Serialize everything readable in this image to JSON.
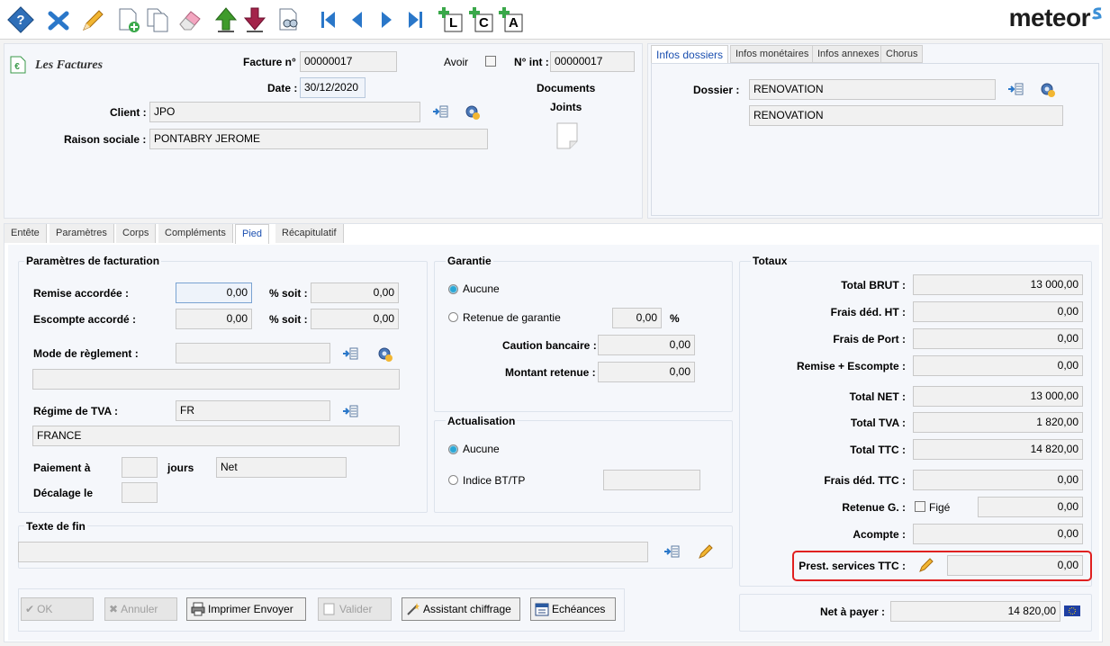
{
  "brand": "meteor",
  "toolbar": {
    "icons": [
      "help-icon",
      "delete-icon",
      "edit-icon",
      "new-doc-icon",
      "copy-doc-icon",
      "eraser-icon",
      "arrow-up-icon",
      "arrow-down-icon",
      "print-preview-icon",
      "first-icon",
      "prev-icon",
      "next-icon",
      "last-icon",
      "add-l-icon",
      "add-c-icon",
      "add-a-icon"
    ],
    "letters": {
      "l": "L",
      "c": "C",
      "a": "A"
    }
  },
  "header": {
    "module_title": "Les Factures",
    "facture_label": "Facture n°",
    "facture_value": "00000017",
    "avoir_label": "Avoir",
    "nint_label": "N° int :",
    "nint_value": "00000017",
    "date_label": "Date :",
    "date_value": "30/12/2020",
    "client_label": "Client :",
    "client_value": "JPO",
    "raison_label": "Raison sociale :",
    "raison_value": "PONTABRY JEROME",
    "documents_label": "Documents",
    "joints_label": "Joints"
  },
  "right_tabs": {
    "tabs": [
      "Infos dossiers",
      "Infos monétaires",
      "Infos annexes",
      "Chorus"
    ],
    "dossier_label": "Dossier :",
    "dossier_value": "RENOVATION",
    "dossier_desc": "RENOVATION"
  },
  "tabs": [
    "Entête",
    "Paramètres",
    "Corps",
    "Compléments",
    "Pied",
    "Récapitulatif"
  ],
  "facturation": {
    "title": "Paramètres de facturation",
    "remise_label": "Remise accordée :",
    "remise_value": "0,00",
    "escompte_label": "Escompte accordé :",
    "escompte_value": "0,00",
    "pct_label": "% soit :",
    "remise_soit": "0,00",
    "escompte_soit": "0,00",
    "mode_label": "Mode de règlement :",
    "regime_label": "Régime de TVA :",
    "regime_value": "FR",
    "regime_desc": "FRANCE",
    "paiement_label": "Paiement à",
    "jours_label": "jours",
    "paiement_type": "Net",
    "decalage_label": "Décalage le"
  },
  "garantie": {
    "title": "Garantie",
    "aucune": "Aucune",
    "retenue_label": "Retenue de garantie",
    "retenue_value": "0,00",
    "pct": "%",
    "caution_label": "Caution bancaire :",
    "caution_value": "0,00",
    "montant_label": "Montant retenue :",
    "montant_value": "0,00"
  },
  "actualisation": {
    "title": "Actualisation",
    "aucune": "Aucune",
    "indice_label": "Indice BT/TP"
  },
  "texte_fin": {
    "title": "Texte de fin"
  },
  "totaux": {
    "title": "Totaux",
    "rows": [
      {
        "label": "Total BRUT :",
        "value": "13 000,00"
      },
      {
        "label": "Frais déd. HT :",
        "value": "0,00"
      },
      {
        "label": "Frais de Port :",
        "value": "0,00"
      },
      {
        "label": "Remise + Escompte :",
        "value": "0,00"
      },
      {
        "label": "Total NET :",
        "value": "13 000,00"
      },
      {
        "label": "Total TVA :",
        "value": "1 820,00"
      },
      {
        "label": "Total TTC :",
        "value": "14 820,00"
      },
      {
        "label": "Frais déd. TTC :",
        "value": "0,00"
      },
      {
        "label": "Retenue G. :",
        "value": "0,00"
      },
      {
        "label": "Acompte :",
        "value": "0,00"
      },
      {
        "label": "Prest. services TTC :",
        "value": "0,00"
      }
    ],
    "fige_label": "Figé",
    "net_label": "Net à payer :",
    "net_value": "14 820,00",
    "highlight_color": "#e02020"
  },
  "buttons": {
    "ok": "OK",
    "annuler": "Annuler",
    "imprimer": "Imprimer Envoyer",
    "valider": "Valider",
    "assistant": "Assistant chiffrage",
    "echeances": "Echéances"
  }
}
